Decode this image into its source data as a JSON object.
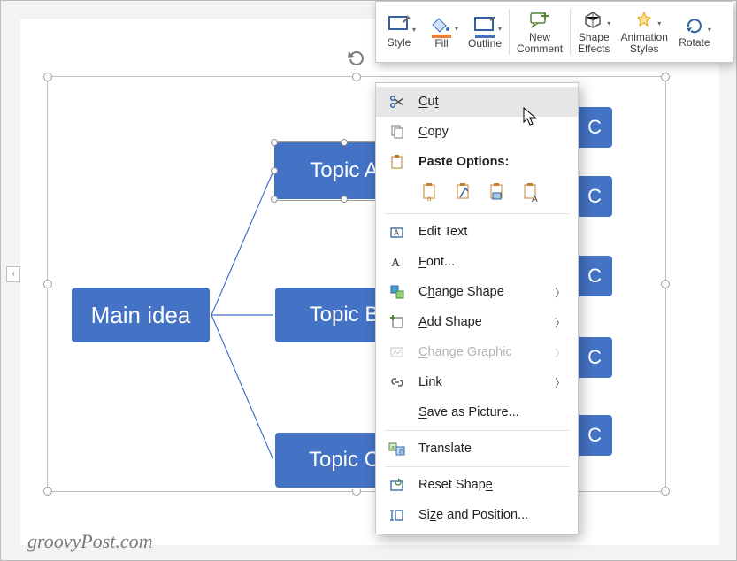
{
  "mini_toolbar": {
    "style": "Style",
    "fill": "Fill",
    "outline": "Outline",
    "new_comment_line1": "New",
    "new_comment_line2": "Comment",
    "shape_effects_line1": "Shape",
    "shape_effects_line2": "Effects",
    "animation_styles_line1": "Animation",
    "animation_styles_line2": "Styles",
    "rotate": "Rotate"
  },
  "smartart": {
    "main": "Main idea",
    "topic_a": "Topic A",
    "topic_b": "Topic B",
    "topic_c": "Topic C",
    "sub_letter": "C"
  },
  "context_menu": {
    "cut": "Cut",
    "copy": "Copy",
    "paste_options": "Paste Options:",
    "edit_text": "Edit Text",
    "font": "Font...",
    "change_shape": "Change Shape",
    "add_shape": "Add Shape",
    "change_graphic": "Change Graphic",
    "link": "Link",
    "save_as_picture": "Save as Picture...",
    "translate": "Translate",
    "reset_shape": "Reset Shape",
    "size_and_position": "Size and Position..."
  },
  "ruler_marker": "‹",
  "watermark": "groovyPost.com"
}
